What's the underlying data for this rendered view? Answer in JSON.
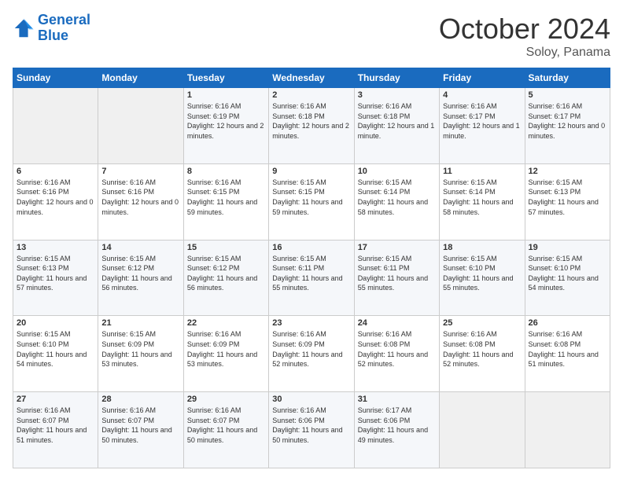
{
  "logo": {
    "line1": "General",
    "line2": "Blue"
  },
  "title": "October 2024",
  "subtitle": "Soloy, Panama",
  "days_of_week": [
    "Sunday",
    "Monday",
    "Tuesday",
    "Wednesday",
    "Thursday",
    "Friday",
    "Saturday"
  ],
  "weeks": [
    [
      {
        "day": "",
        "info": ""
      },
      {
        "day": "",
        "info": ""
      },
      {
        "day": "1",
        "info": "Sunrise: 6:16 AM\nSunset: 6:19 PM\nDaylight: 12 hours and 2 minutes."
      },
      {
        "day": "2",
        "info": "Sunrise: 6:16 AM\nSunset: 6:18 PM\nDaylight: 12 hours and 2 minutes."
      },
      {
        "day": "3",
        "info": "Sunrise: 6:16 AM\nSunset: 6:18 PM\nDaylight: 12 hours and 1 minute."
      },
      {
        "day": "4",
        "info": "Sunrise: 6:16 AM\nSunset: 6:17 PM\nDaylight: 12 hours and 1 minute."
      },
      {
        "day": "5",
        "info": "Sunrise: 6:16 AM\nSunset: 6:17 PM\nDaylight: 12 hours and 0 minutes."
      }
    ],
    [
      {
        "day": "6",
        "info": "Sunrise: 6:16 AM\nSunset: 6:16 PM\nDaylight: 12 hours and 0 minutes."
      },
      {
        "day": "7",
        "info": "Sunrise: 6:16 AM\nSunset: 6:16 PM\nDaylight: 12 hours and 0 minutes."
      },
      {
        "day": "8",
        "info": "Sunrise: 6:16 AM\nSunset: 6:15 PM\nDaylight: 11 hours and 59 minutes."
      },
      {
        "day": "9",
        "info": "Sunrise: 6:15 AM\nSunset: 6:15 PM\nDaylight: 11 hours and 59 minutes."
      },
      {
        "day": "10",
        "info": "Sunrise: 6:15 AM\nSunset: 6:14 PM\nDaylight: 11 hours and 58 minutes."
      },
      {
        "day": "11",
        "info": "Sunrise: 6:15 AM\nSunset: 6:14 PM\nDaylight: 11 hours and 58 minutes."
      },
      {
        "day": "12",
        "info": "Sunrise: 6:15 AM\nSunset: 6:13 PM\nDaylight: 11 hours and 57 minutes."
      }
    ],
    [
      {
        "day": "13",
        "info": "Sunrise: 6:15 AM\nSunset: 6:13 PM\nDaylight: 11 hours and 57 minutes."
      },
      {
        "day": "14",
        "info": "Sunrise: 6:15 AM\nSunset: 6:12 PM\nDaylight: 11 hours and 56 minutes."
      },
      {
        "day": "15",
        "info": "Sunrise: 6:15 AM\nSunset: 6:12 PM\nDaylight: 11 hours and 56 minutes."
      },
      {
        "day": "16",
        "info": "Sunrise: 6:15 AM\nSunset: 6:11 PM\nDaylight: 11 hours and 55 minutes."
      },
      {
        "day": "17",
        "info": "Sunrise: 6:15 AM\nSunset: 6:11 PM\nDaylight: 11 hours and 55 minutes."
      },
      {
        "day": "18",
        "info": "Sunrise: 6:15 AM\nSunset: 6:10 PM\nDaylight: 11 hours and 55 minutes."
      },
      {
        "day": "19",
        "info": "Sunrise: 6:15 AM\nSunset: 6:10 PM\nDaylight: 11 hours and 54 minutes."
      }
    ],
    [
      {
        "day": "20",
        "info": "Sunrise: 6:15 AM\nSunset: 6:10 PM\nDaylight: 11 hours and 54 minutes."
      },
      {
        "day": "21",
        "info": "Sunrise: 6:15 AM\nSunset: 6:09 PM\nDaylight: 11 hours and 53 minutes."
      },
      {
        "day": "22",
        "info": "Sunrise: 6:16 AM\nSunset: 6:09 PM\nDaylight: 11 hours and 53 minutes."
      },
      {
        "day": "23",
        "info": "Sunrise: 6:16 AM\nSunset: 6:09 PM\nDaylight: 11 hours and 52 minutes."
      },
      {
        "day": "24",
        "info": "Sunrise: 6:16 AM\nSunset: 6:08 PM\nDaylight: 11 hours and 52 minutes."
      },
      {
        "day": "25",
        "info": "Sunrise: 6:16 AM\nSunset: 6:08 PM\nDaylight: 11 hours and 52 minutes."
      },
      {
        "day": "26",
        "info": "Sunrise: 6:16 AM\nSunset: 6:08 PM\nDaylight: 11 hours and 51 minutes."
      }
    ],
    [
      {
        "day": "27",
        "info": "Sunrise: 6:16 AM\nSunset: 6:07 PM\nDaylight: 11 hours and 51 minutes."
      },
      {
        "day": "28",
        "info": "Sunrise: 6:16 AM\nSunset: 6:07 PM\nDaylight: 11 hours and 50 minutes."
      },
      {
        "day": "29",
        "info": "Sunrise: 6:16 AM\nSunset: 6:07 PM\nDaylight: 11 hours and 50 minutes."
      },
      {
        "day": "30",
        "info": "Sunrise: 6:16 AM\nSunset: 6:06 PM\nDaylight: 11 hours and 50 minutes."
      },
      {
        "day": "31",
        "info": "Sunrise: 6:17 AM\nSunset: 6:06 PM\nDaylight: 11 hours and 49 minutes."
      },
      {
        "day": "",
        "info": ""
      },
      {
        "day": "",
        "info": ""
      }
    ]
  ]
}
